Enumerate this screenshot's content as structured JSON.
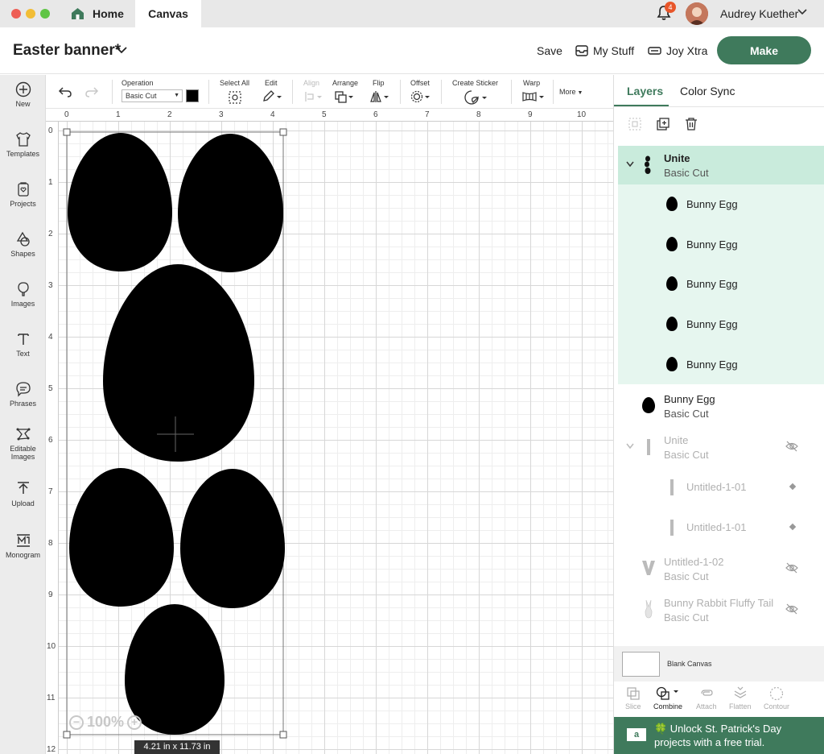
{
  "window": {
    "tabs": [
      {
        "label": "Home"
      },
      {
        "label": "Canvas"
      }
    ],
    "notifications_count": "4",
    "user_name": "Audrey Kuether"
  },
  "header": {
    "project_title": "Easter banner*",
    "save_label": "Save",
    "my_stuff_label": "My Stuff",
    "joy_xtra_label": "Joy Xtra",
    "make_label": "Make"
  },
  "sidebar": {
    "items": [
      {
        "label": "New",
        "icon": "plus-circle-icon"
      },
      {
        "label": "Templates",
        "icon": "shirt-icon"
      },
      {
        "label": "Projects",
        "icon": "projects-icon"
      },
      {
        "label": "Shapes",
        "icon": "shapes-icon"
      },
      {
        "label": "Images",
        "icon": "balloon-icon"
      },
      {
        "label": "Text",
        "icon": "text-icon"
      },
      {
        "label": "Phrases",
        "icon": "speech-bubble-icon"
      },
      {
        "label": "Editable Images",
        "icon": "editable-images-icon"
      },
      {
        "label": "Upload",
        "icon": "upload-icon"
      },
      {
        "label": "Monogram",
        "icon": "monogram-icon"
      }
    ]
  },
  "toolbar": {
    "operation_label": "Operation",
    "operation_value": "Basic Cut",
    "operation_color": "#000000",
    "select_all_label": "Select All",
    "edit_label": "Edit",
    "align_label": "Align",
    "arrange_label": "Arrange",
    "flip_label": "Flip",
    "offset_label": "Offset",
    "create_sticker_label": "Create Sticker",
    "warp_label": "Warp",
    "more_label": "More"
  },
  "canvas": {
    "ruler_x": [
      "0",
      "1",
      "2",
      "3",
      "4",
      "5",
      "6",
      "7",
      "8",
      "9",
      "10"
    ],
    "ruler_y": [
      "0",
      "1",
      "2",
      "3",
      "4",
      "5",
      "6",
      "7",
      "8",
      "9",
      "10",
      "11",
      "12"
    ],
    "zoom_level": "100%",
    "selection_dimensions": "4.21  in x 11.73  in"
  },
  "layers_panel": {
    "tabs": [
      {
        "label": "Layers"
      },
      {
        "label": "Color Sync"
      }
    ],
    "group": {
      "name": "Unite",
      "operation": "Basic Cut"
    },
    "group_children": [
      {
        "name": "Bunny Egg"
      },
      {
        "name": "Bunny Egg"
      },
      {
        "name": "Bunny Egg"
      },
      {
        "name": "Bunny Egg"
      },
      {
        "name": "Bunny Egg"
      }
    ],
    "layer_bunny_egg": {
      "name": "Bunny Egg",
      "operation": "Basic Cut"
    },
    "hidden_group": {
      "name": "Unite",
      "operation": "Basic Cut"
    },
    "hidden_children": [
      {
        "name": "Untitled-1-01"
      },
      {
        "name": "Untitled-1-01"
      }
    ],
    "hidden_layer_1": {
      "name": "Untitled-1-02",
      "operation": "Basic Cut"
    },
    "hidden_layer_2": {
      "name": "Bunny Rabbit Fluffy Tail",
      "operation": "Basic Cut"
    },
    "blank_canvas_label": "Blank Canvas",
    "bottom_tools": [
      {
        "label": "Slice"
      },
      {
        "label": "Combine"
      },
      {
        "label": "Attach"
      },
      {
        "label": "Flatten"
      },
      {
        "label": "Contour"
      }
    ],
    "promo": {
      "logo": "a",
      "text": "🍀 Unlock St. Patrick's Day projects with a free trial."
    }
  },
  "colors": {
    "brand_green": "#3f7a5c",
    "selected_layer_bg": "#c9ebdc",
    "selected_child_bg": "#e6f6ef"
  }
}
